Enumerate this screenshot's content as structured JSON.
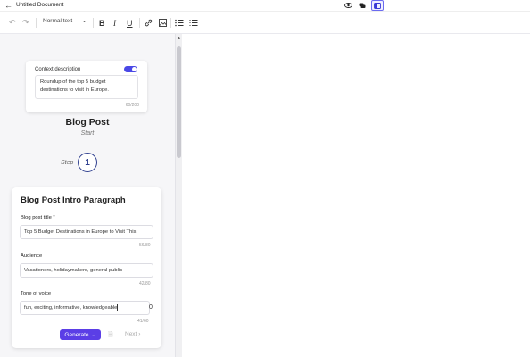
{
  "app": {
    "title": "Untitled Document"
  },
  "toolbar": {
    "text_style": "Normal text"
  },
  "context": {
    "label": "Context description",
    "text": "Roundup of the top 5 budget destinations to visit in Europe.",
    "count": "60/200"
  },
  "node": {
    "title": "Blog Post",
    "subtitle": "Start"
  },
  "step": {
    "label": "Step",
    "number": "1"
  },
  "form": {
    "title": "Blog Post Intro Paragraph",
    "fields": [
      {
        "label": "Blog post title *",
        "value": "Top 5 Budget Destinations in Europe to Visit This",
        "count": "56/80"
      },
      {
        "label": "Audience",
        "value": "Vacationers, holidaymakers, general public",
        "count": "42/80"
      },
      {
        "label": "Tone of voice",
        "value": "fun, exciting, informative, knowledgeable",
        "count": "41/60",
        "clear": "0"
      }
    ],
    "generate_label": "Generate",
    "next_label": "Next"
  },
  "colors": {
    "accent": "#5b3ee6",
    "toggle": "#4a48e6",
    "step": "#2f3f8f"
  }
}
